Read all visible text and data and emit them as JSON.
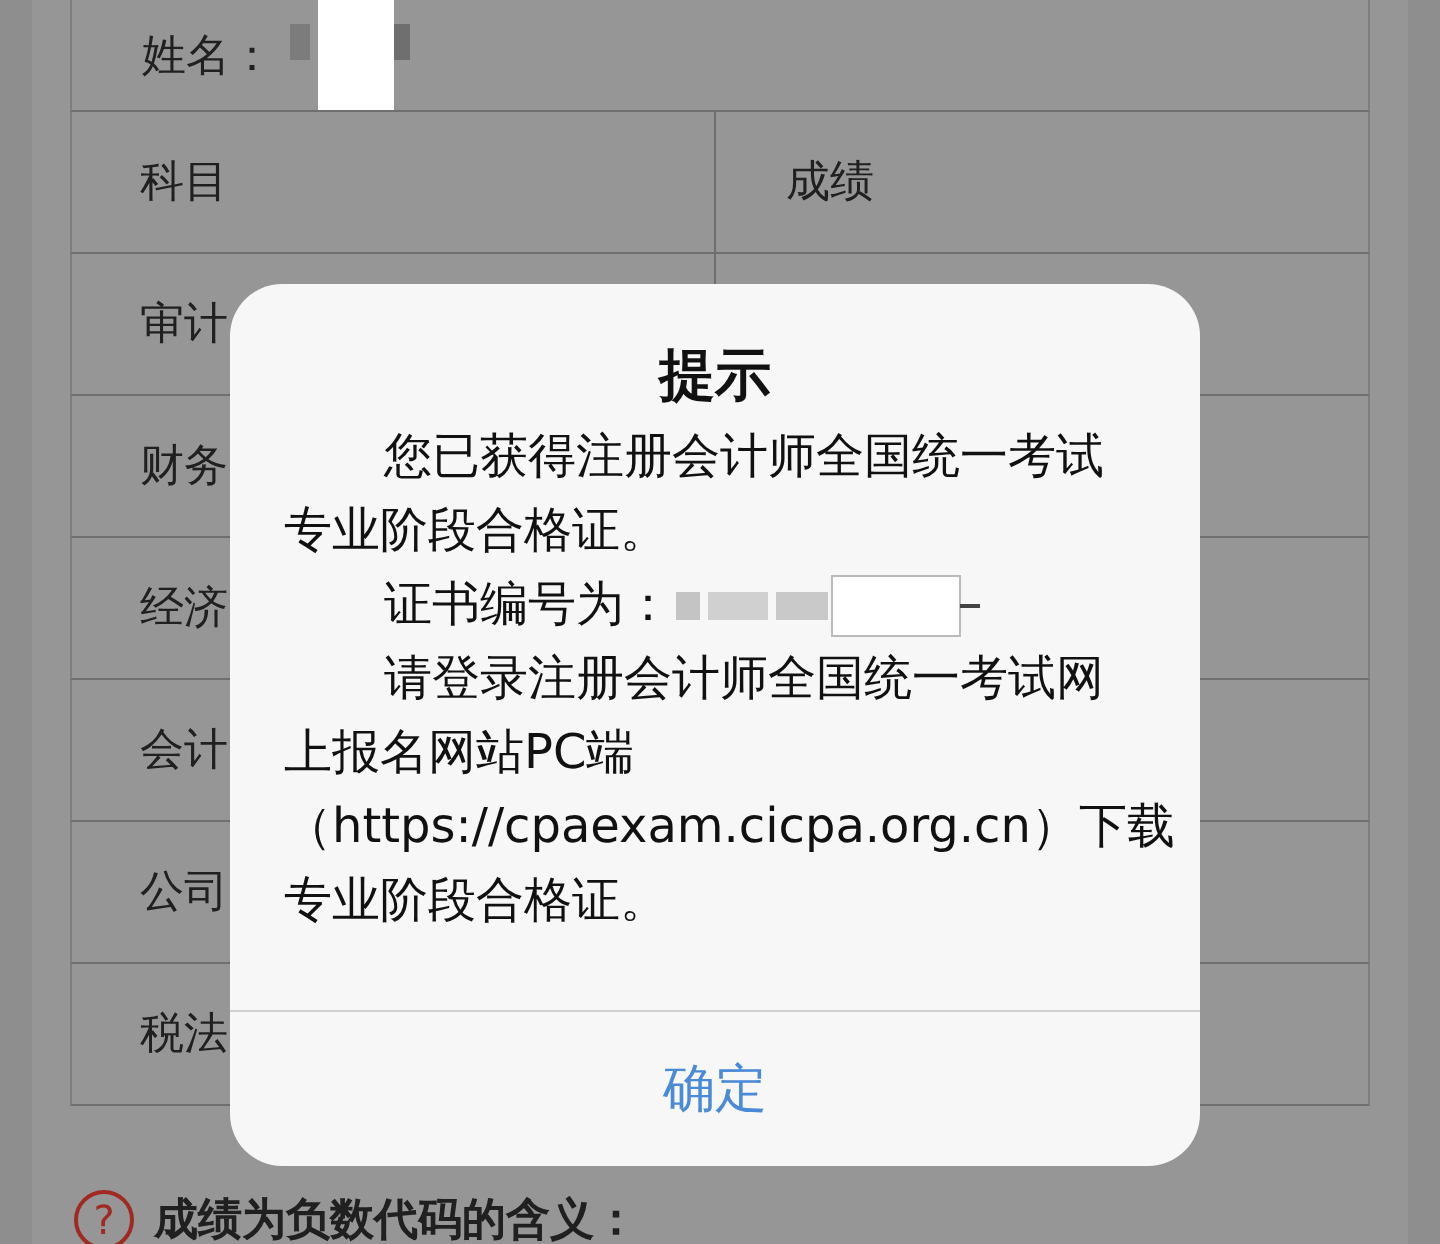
{
  "name_row": {
    "label": "姓名："
  },
  "table": {
    "columns": [
      "科目",
      "成绩"
    ],
    "rows": [
      {
        "subject": "审计"
      },
      {
        "subject": "财务"
      },
      {
        "subject": "经济"
      },
      {
        "subject": "会计"
      },
      {
        "subject": "公司"
      },
      {
        "subject": "税法"
      }
    ]
  },
  "dialog": {
    "title": "提示",
    "paragraphs": [
      {
        "lines": [
          "您已获得注册会计师全国统一考试",
          "专业阶段合格证。"
        ]
      },
      {
        "lines": [
          "证书编号为："
        ],
        "redacted": true
      },
      {
        "lines": [
          "请登录注册会计师全国统一考试网",
          "上报名网站PC端",
          "（https://cpaexam.cicpa.org.cn）下载",
          "专业阶段合格证。"
        ]
      }
    ],
    "button": "确定"
  },
  "note": {
    "icon": "?",
    "text": "成绩为负数代码的含义："
  }
}
